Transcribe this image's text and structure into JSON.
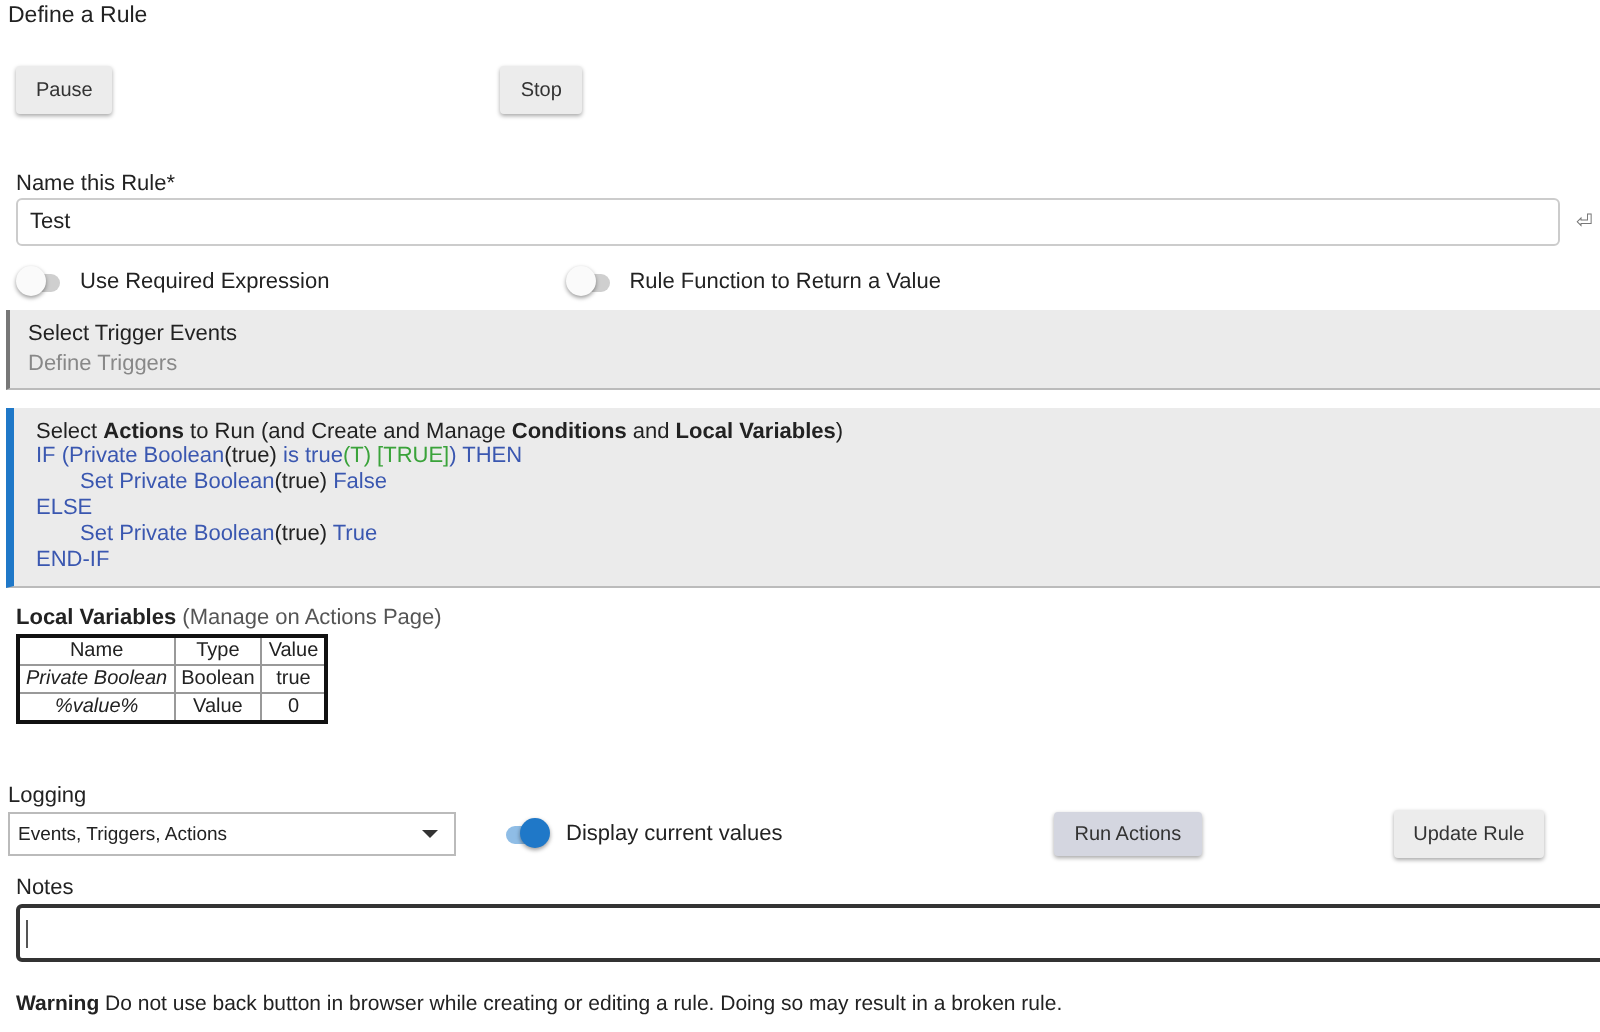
{
  "page_title": "Define a Rule",
  "control_buttons": [
    "Pause",
    "Stop"
  ],
  "name_field": {
    "label": "Name this Rule*",
    "value": "Test",
    "trailing_symbol": "⏎"
  },
  "options": [
    {
      "label": "Use Required Expression",
      "on": false
    },
    {
      "label": "Rule Function to Return a Value",
      "on": false
    }
  ],
  "triggers_panel": {
    "title": "Select Trigger Events",
    "subtitle": "Define Triggers"
  },
  "actions_panel": {
    "title": "Select **Actions** to Run (and Create and Manage **Conditions** and **Local Variables**)",
    "lines": [
      {
        "segments": [
          {
            "kind": "keyword",
            "text": "IF (Private Boolean"
          },
          {
            "kind": "plain",
            "text": "(true)"
          },
          {
            "kind": "keyword",
            "text": " is true"
          },
          {
            "kind": "state",
            "text": "(T) [TRUE]"
          },
          {
            "kind": "keyword",
            "text": ") THEN"
          }
        ],
        "children": [
          {
            "segments": [
              {
                "kind": "keyword",
                "text": "Set Private Boolean"
              },
              {
                "kind": "plain",
                "text": "(true)"
              },
              {
                "kind": "keyword",
                "text": " False"
              }
            ]
          }
        ]
      },
      {
        "segments": [
          {
            "kind": "keyword",
            "text": "ELSE"
          }
        ],
        "children": [
          {
            "segments": [
              {
                "kind": "keyword",
                "text": "Set Private Boolean"
              },
              {
                "kind": "plain",
                "text": "(true)"
              },
              {
                "kind": "keyword",
                "text": " True"
              }
            ]
          }
        ]
      },
      {
        "segments": [
          {
            "kind": "keyword",
            "text": "END-IF"
          }
        ]
      }
    ]
  },
  "local_variables": {
    "title": "Local Variables",
    "note": "(Manage on Actions Page)",
    "columns": [
      "Name",
      "Type",
      "Value"
    ],
    "rows": [
      [
        "Private Boolean",
        "Boolean",
        "true"
      ],
      [
        "%value%",
        "Value",
        "0"
      ]
    ]
  },
  "logging": {
    "label": "Logging",
    "value": "Events, Triggers, Actions"
  },
  "display_values": {
    "label": "Display current values",
    "on": true
  },
  "action_buttons": [
    "Run Actions",
    "Update Rule"
  ],
  "notes": {
    "label": "Notes"
  },
  "warning": "**Warning** Do not use back button in browser while creating or editing a rule. Doing so may result in a broken rule."
}
